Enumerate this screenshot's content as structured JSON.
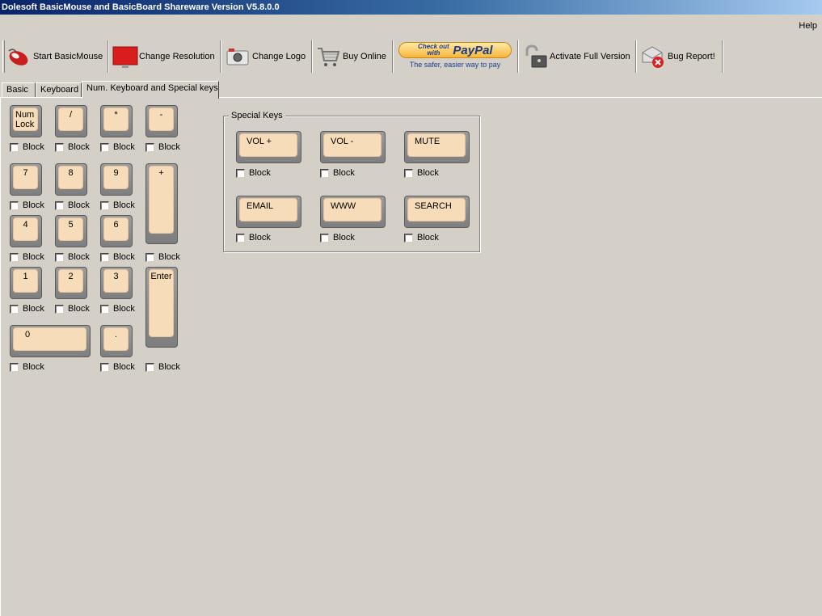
{
  "window": {
    "title": "Dolesoft BasicMouse and BasicBoard Shareware Version V5.8.0.0"
  },
  "menu": {
    "help": "Help"
  },
  "toolbar": {
    "start": "Start BasicMouse",
    "resolution": "Change Resolution",
    "logo": "Change Logo",
    "buy": "Buy Online",
    "paypal_small": "Check out with",
    "paypal_brand": "PayPal",
    "paypal_tagline": "The safer, easier way to pay",
    "activate": "Activate Full Version",
    "bug": "Bug Report!"
  },
  "tabs": [
    "Basic",
    "Keyboard",
    "Num. Keyboard and Special keys"
  ],
  "numpad": {
    "block_label": "Block",
    "keys": {
      "numlock": "Num\nLock",
      "divide": "/",
      "multiply": "*",
      "minus": "-",
      "k7": "7",
      "k8": "8",
      "k9": "9",
      "plus": "+",
      "k4": "4",
      "k5": "5",
      "k6": "6",
      "k1": "1",
      "k2": "2",
      "k3": "3",
      "enter": "Enter",
      "k0": "0",
      "decimal": "."
    }
  },
  "special": {
    "title": "Special Keys",
    "block_label": "Block",
    "keys": {
      "vol_up": "VOL +",
      "vol_down": "VOL -",
      "mute": "MUTE",
      "email": "EMAIL",
      "www": "WWW",
      "search": "SEARCH"
    }
  },
  "colors": {
    "keycap": "#f6dcb8",
    "key_base": "#8c8c8c",
    "window_bg": "#d4d0c8",
    "title_start": "#0a246a",
    "title_end": "#a6caf0"
  }
}
